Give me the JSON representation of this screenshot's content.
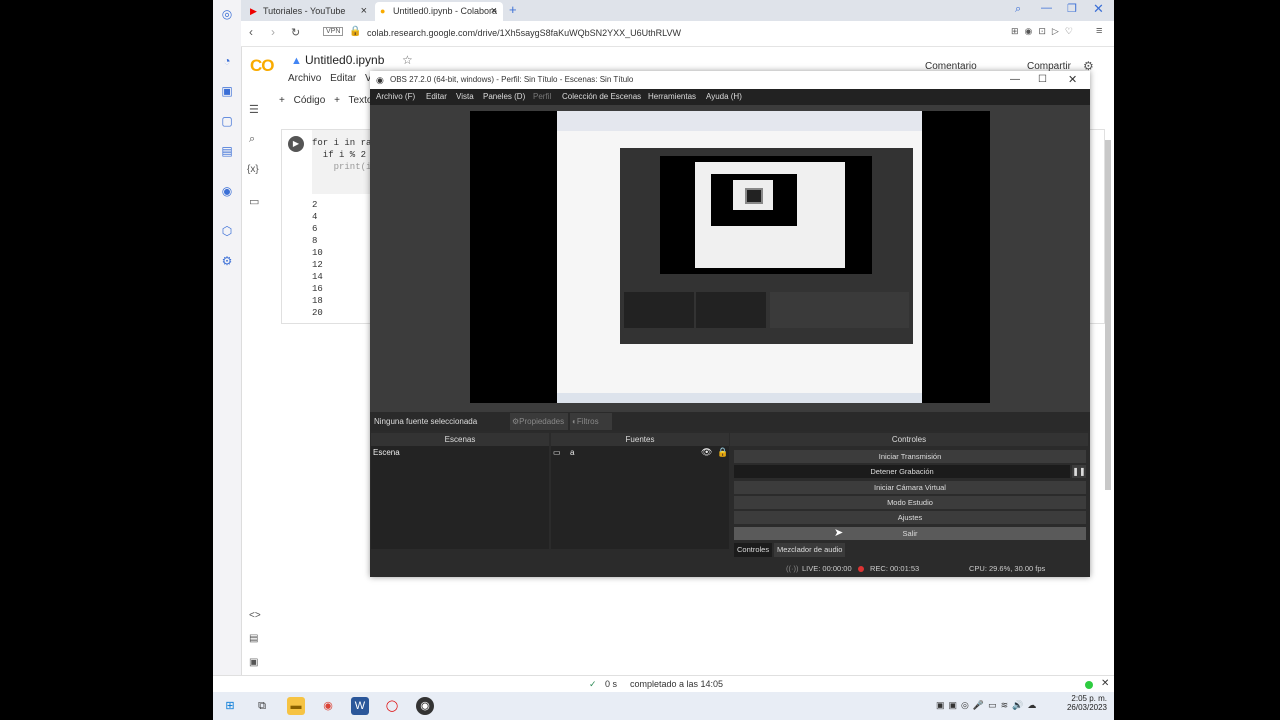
{
  "browser": {
    "tabs": [
      {
        "label": "Tutoriales - YouTube",
        "close": "×"
      },
      {
        "label": "Untitled0.ipynb - Colabora",
        "close": "×"
      }
    ],
    "new_tab": "+",
    "vpn": "VPN",
    "url": "colab.research.google.com/drive/1Xh5saygS8faKuWQbSN2YXX_U6UthRLVW"
  },
  "colab": {
    "logo": "CO",
    "notebook_title": "Untitled0.ipynb",
    "menu": [
      "Archivo",
      "Editar",
      "Ve"
    ],
    "toolbar": {
      "code": "+ Código",
      "text": "+ Texto"
    },
    "comment": "Comentario",
    "share": "Compartir",
    "code_lines": [
      "for i in ra",
      "  if i % 2",
      "    print(i"
    ],
    "outputs": [
      "2",
      "4",
      "6",
      "8",
      "10",
      "12",
      "14",
      "16",
      "18",
      "20"
    ],
    "status": {
      "duration": "0 s",
      "completed": "completado a las 14:05"
    }
  },
  "obs": {
    "title": "OBS 27.2.0 (64-bit, windows) - Perfil: Sin Título - Escenas: Sin Título",
    "menu": [
      "Archivo (F)",
      "Editar",
      "Vista",
      "Paneles (D)",
      "Perfil",
      "Colección de Escenas",
      "Herramientas",
      "Ayuda (H)"
    ],
    "no_source": "Ninguna fuente seleccionada",
    "properties": "Propiedades",
    "filters": "Filtros",
    "docks": {
      "scenes": "Escenas",
      "sources": "Fuentes",
      "controls": "Controles"
    },
    "scene_item": "Escena",
    "source_item": "a",
    "controls": {
      "start_stream": "Iniciar Transmisión",
      "stop_recording": "Detener Grabación",
      "virtual_cam": "Iniciar Cámara Virtual",
      "studio_mode": "Modo Estudio",
      "settings": "Ajustes",
      "exit": "Salir"
    },
    "bottom_tabs": [
      "Controles",
      "Mezclador de audio"
    ],
    "status": {
      "live": "LIVE: 00:00:00",
      "rec": "REC: 00:01:53",
      "cpu": "CPU: 29.6%, 30.00 fps"
    }
  },
  "taskbar": {
    "time": "2:05 p. m.",
    "date": "26/03/2023"
  }
}
